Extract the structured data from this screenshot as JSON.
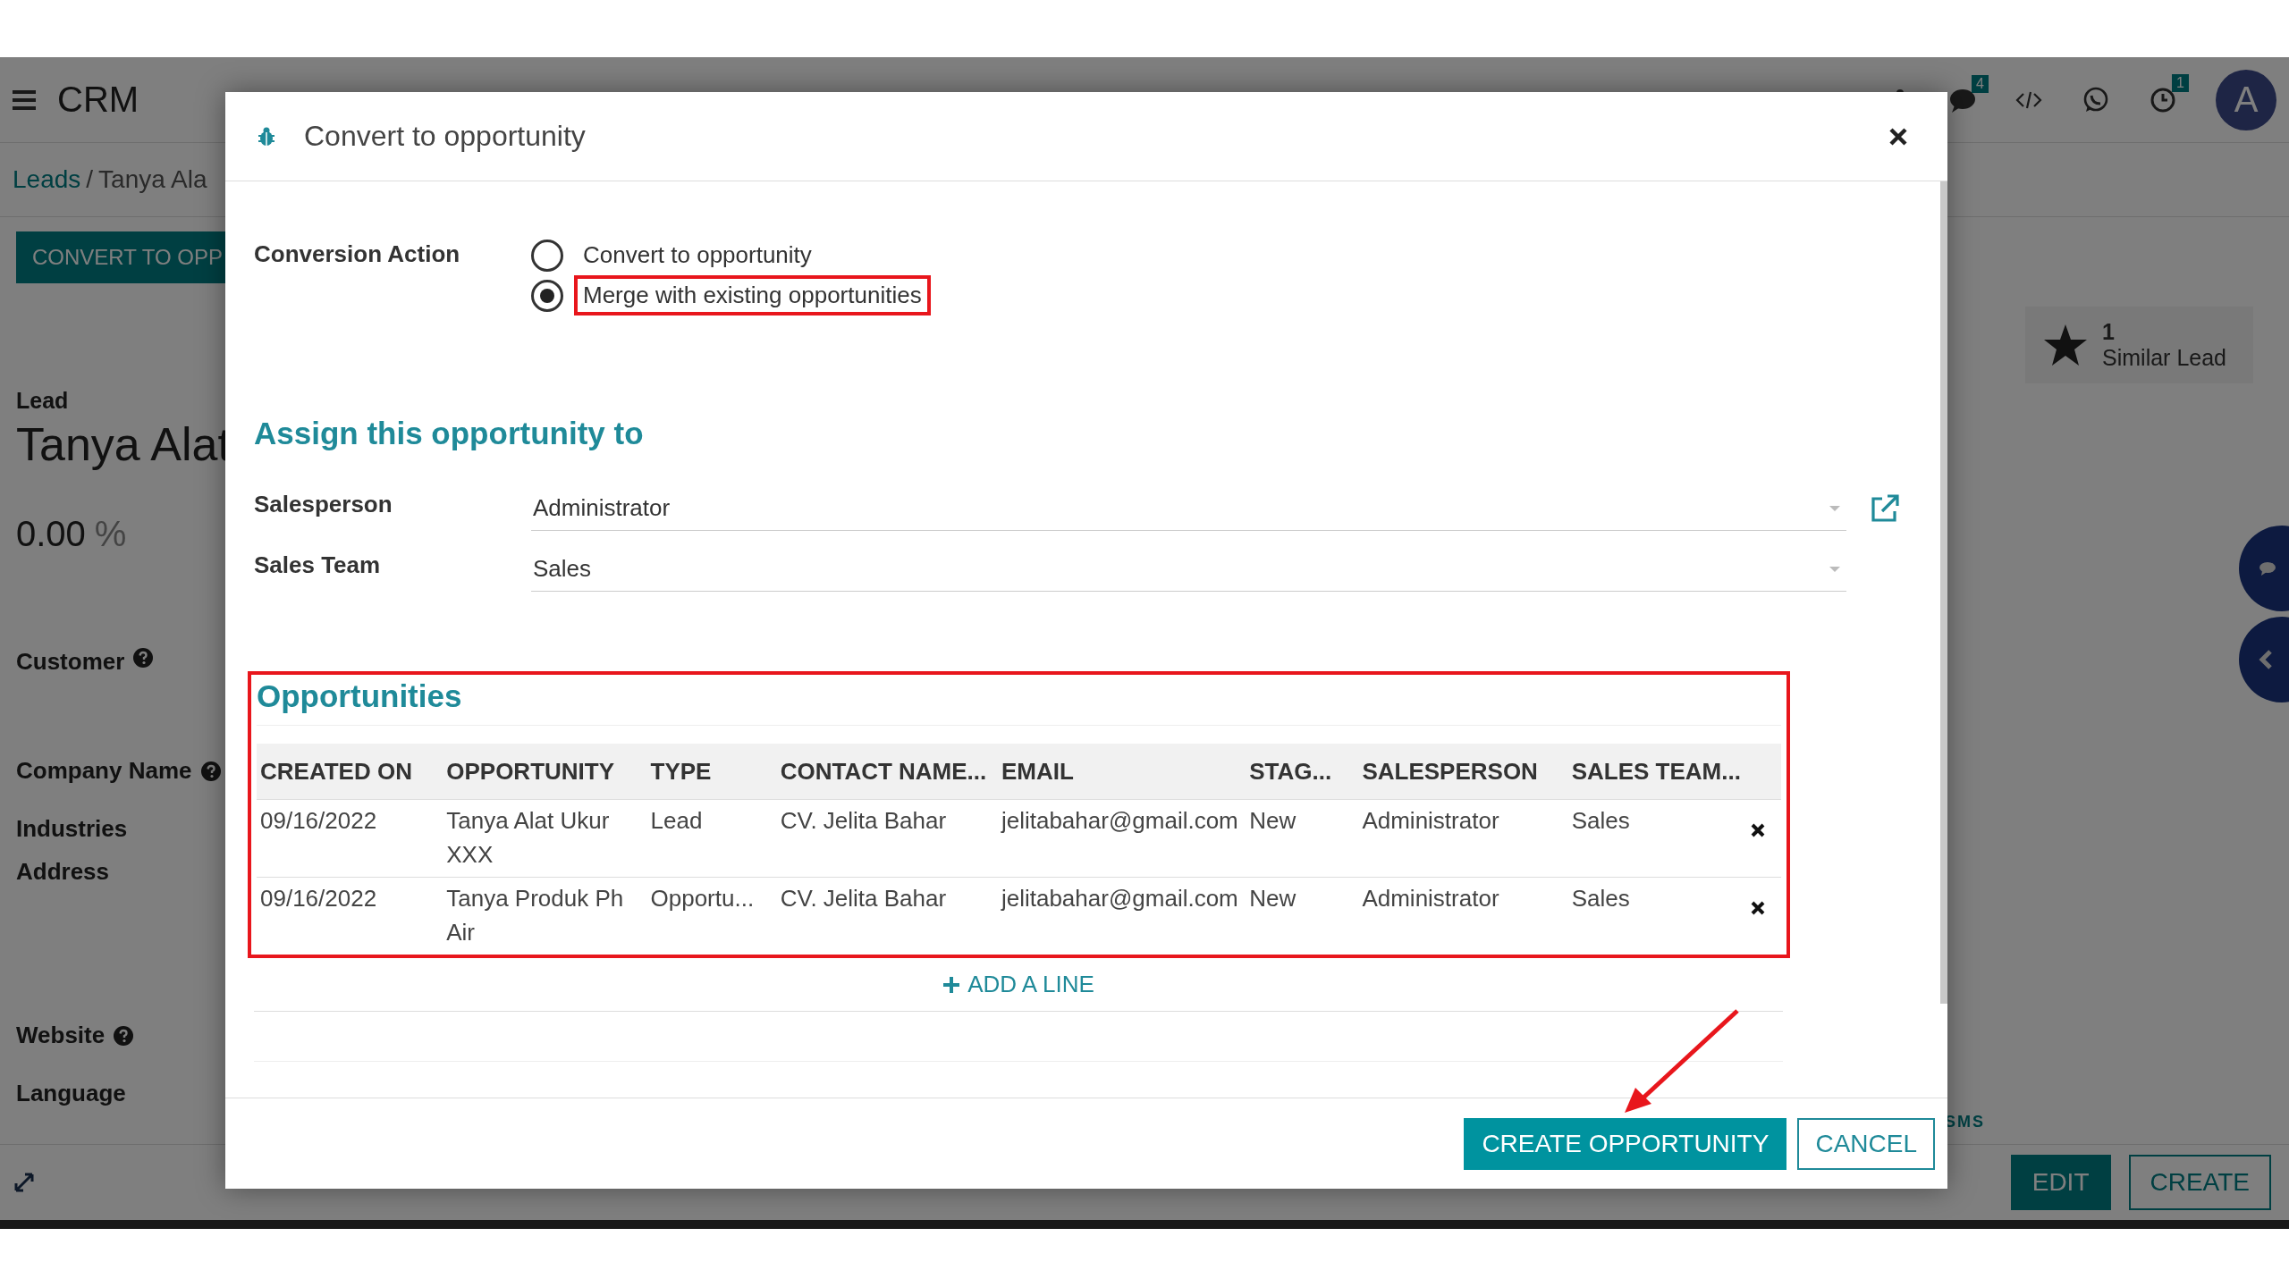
{
  "navbar": {
    "app_name": "CRM",
    "message_count": "4",
    "activity_count": "1",
    "avatar": "A"
  },
  "breadcrumb": {
    "parent": "Leads",
    "separator": "/",
    "current": "Tanya Ala"
  },
  "control_panel": {
    "action_button": "CONVERT TO OPP",
    "stat_button": {
      "count": "1",
      "label": "Similar Lead"
    }
  },
  "record": {
    "kind_label": "Lead",
    "title": "Tanya Alat",
    "probability": "0.00",
    "probability_unit": "%",
    "fields": [
      {
        "label": "Customer",
        "help": true
      },
      {
        "label": "Company Name",
        "help": true
      },
      {
        "label": "Industries",
        "help": false
      },
      {
        "label": "Address",
        "help": false
      },
      {
        "label": "Website",
        "help": true
      },
      {
        "label": "Language",
        "help": false
      }
    ]
  },
  "chatter": {
    "sms_label": "SMS"
  },
  "footer_buttons": [
    {
      "label": "EDIT",
      "primary": true
    },
    {
      "label": "CREATE",
      "primary": false
    }
  ],
  "dialog": {
    "title": "Convert to opportunity",
    "conversion": {
      "label": "Conversion Action",
      "options": [
        {
          "label": "Convert to opportunity",
          "selected": false,
          "highlighted": false
        },
        {
          "label": "Merge with existing opportunities",
          "selected": true,
          "highlighted": true
        }
      ]
    },
    "assign": {
      "heading": "Assign this opportunity to",
      "fields": [
        {
          "label": "Salesperson",
          "value": "Administrator",
          "external_link": true
        },
        {
          "label": "Sales Team",
          "value": "Sales",
          "external_link": false
        }
      ]
    },
    "opportunities": {
      "heading": "Opportunities",
      "highlighted": true,
      "columns": [
        "CREATED ON",
        "OPPORTUNITY",
        "TYPE",
        "CONTACT NAME...",
        "EMAIL",
        "STAG...",
        "SALESPERSON",
        "SALES TEAM..."
      ],
      "rows": [
        {
          "cells": [
            "09/16/2022",
            "Tanya Alat Ukur XXX",
            "Lead",
            "CV. Jelita Bahar",
            "jelitabahar@gmail.com",
            "New",
            "Administrator",
            "Sales"
          ]
        },
        {
          "cells": [
            "09/16/2022",
            "Tanya Produk Ph Air",
            "Opportu...",
            "CV. Jelita Bahar",
            "jelitabahar@gmail.com",
            "New",
            "Administrator",
            "Sales"
          ]
        }
      ],
      "add_line": "ADD A LINE"
    },
    "buttons": [
      {
        "label": "CREATE OPPORTUNITY",
        "primary": true,
        "pointed_at": true
      },
      {
        "label": "CANCEL",
        "primary": false,
        "pointed_at": false
      }
    ]
  }
}
